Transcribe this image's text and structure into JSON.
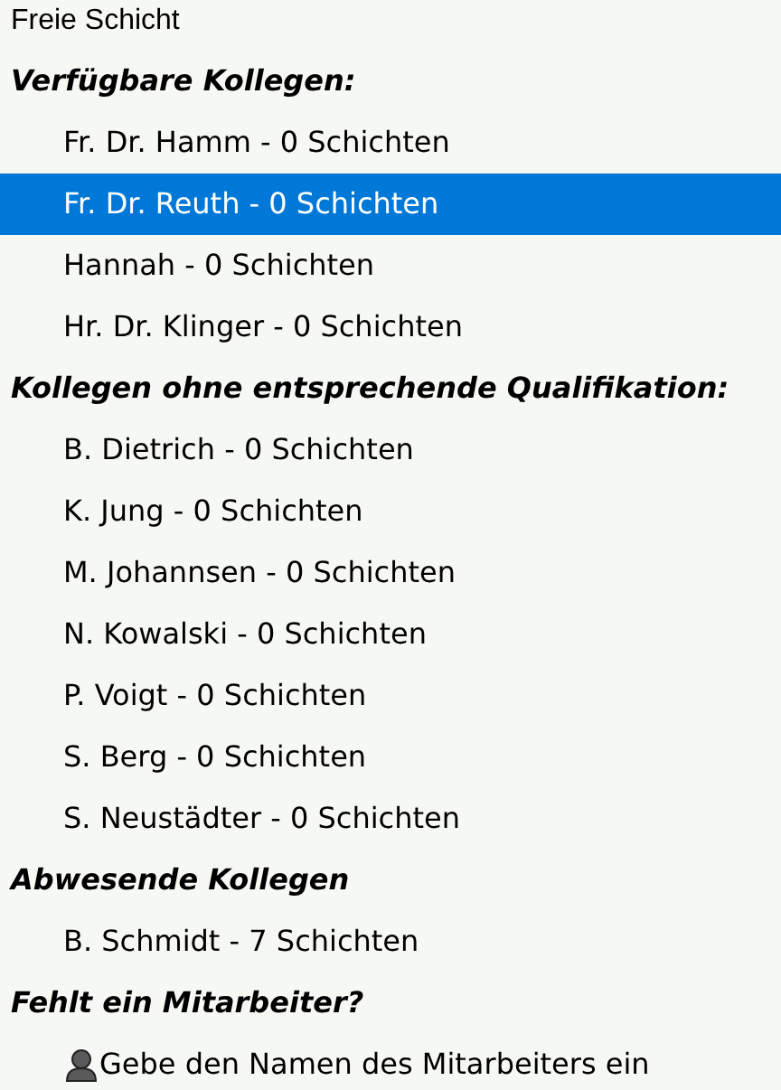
{
  "top_option": {
    "label": "Freie Schicht",
    "selected": false
  },
  "groups": [
    {
      "heading": "Verfügbare Kollegen:",
      "items": [
        {
          "kind": "colleague",
          "label": "Fr. Dr. Hamm - 0 Schichten",
          "selected": false
        },
        {
          "kind": "colleague",
          "label": "Fr. Dr. Reuth - 0 Schichten",
          "selected": true
        },
        {
          "kind": "colleague",
          "label": "Hannah - 0 Schichten",
          "selected": false
        },
        {
          "kind": "colleague",
          "label": "Hr. Dr. Klinger - 0 Schichten",
          "selected": false
        }
      ]
    },
    {
      "heading": "Kollegen ohne entsprechende Qualifikation:",
      "items": [
        {
          "kind": "colleague",
          "label": "B. Dietrich - 0 Schichten",
          "selected": false
        },
        {
          "kind": "colleague",
          "label": "K. Jung - 0 Schichten",
          "selected": false
        },
        {
          "kind": "colleague",
          "label": "M. Johannsen - 0 Schichten",
          "selected": false
        },
        {
          "kind": "colleague",
          "label": "N. Kowalski - 0 Schichten",
          "selected": false
        },
        {
          "kind": "colleague",
          "label": "P. Voigt - 0 Schichten",
          "selected": false
        },
        {
          "kind": "colleague",
          "label": "S. Berg - 0 Schichten",
          "selected": false
        },
        {
          "kind": "colleague",
          "label": "S. Neustädter - 0 Schichten",
          "selected": false
        }
      ]
    },
    {
      "heading": "Abwesende Kollegen",
      "items": [
        {
          "kind": "colleague",
          "label": "B. Schmidt - 7 Schichten",
          "selected": false
        }
      ]
    },
    {
      "heading": "Fehlt ein Mitarbeiter?",
      "items": [
        {
          "kind": "add_person",
          "label": "Gebe den Namen des Mitarbeiters ein",
          "selected": false
        }
      ]
    }
  ]
}
